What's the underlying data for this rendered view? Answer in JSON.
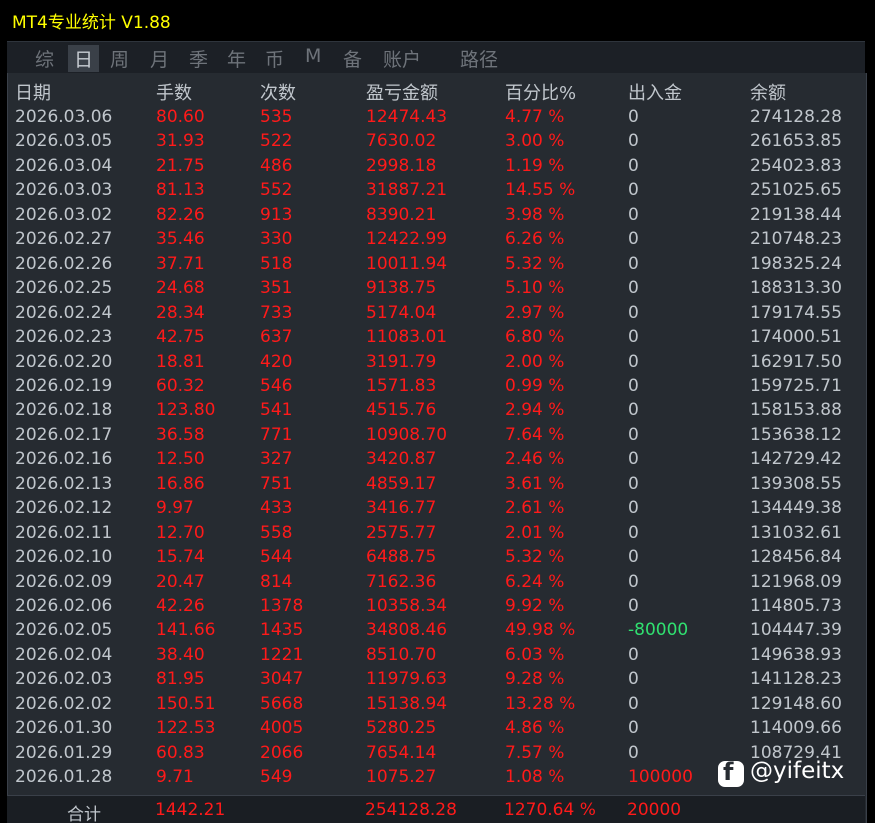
{
  "window": {
    "title": "MT4专业统计 V1.88"
  },
  "tabs": [
    {
      "label": "综",
      "active": false
    },
    {
      "label": "日",
      "active": true
    },
    {
      "label": "周",
      "active": false
    },
    {
      "label": "月",
      "active": false
    },
    {
      "label": "季",
      "active": false
    },
    {
      "label": "年",
      "active": false
    },
    {
      "label": "币",
      "active": false
    },
    {
      "label": "M",
      "active": false
    },
    {
      "label": "备",
      "active": false
    },
    {
      "label": "账户",
      "active": false
    },
    {
      "label": "路径",
      "active": false
    }
  ],
  "table": {
    "headers": {
      "date": "日期",
      "lots": "手数",
      "count": "次数",
      "pl": "盈亏金额",
      "pct": "百分比%",
      "deposit": "出入金",
      "balance": "余额"
    },
    "rows": [
      {
        "date": "2026.03.06",
        "lots": "80.60",
        "count": "535",
        "pl": "12474.43",
        "pct": "4.77 %",
        "deposit": "0",
        "balance": "274128.28"
      },
      {
        "date": "2026.03.05",
        "lots": "31.93",
        "count": "522",
        "pl": "7630.02",
        "pct": "3.00 %",
        "deposit": "0",
        "balance": "261653.85"
      },
      {
        "date": "2026.03.04",
        "lots": "21.75",
        "count": "486",
        "pl": "2998.18",
        "pct": "1.19 %",
        "deposit": "0",
        "balance": "254023.83"
      },
      {
        "date": "2026.03.03",
        "lots": "81.13",
        "count": "552",
        "pl": "31887.21",
        "pct": "14.55 %",
        "deposit": "0",
        "balance": "251025.65"
      },
      {
        "date": "2026.03.02",
        "lots": "82.26",
        "count": "913",
        "pl": "8390.21",
        "pct": "3.98 %",
        "deposit": "0",
        "balance": "219138.44"
      },
      {
        "date": "2026.02.27",
        "lots": "35.46",
        "count": "330",
        "pl": "12422.99",
        "pct": "6.26 %",
        "deposit": "0",
        "balance": "210748.23"
      },
      {
        "date": "2026.02.26",
        "lots": "37.71",
        "count": "518",
        "pl": "10011.94",
        "pct": "5.32 %",
        "deposit": "0",
        "balance": "198325.24"
      },
      {
        "date": "2026.02.25",
        "lots": "24.68",
        "count": "351",
        "pl": "9138.75",
        "pct": "5.10 %",
        "deposit": "0",
        "balance": "188313.30"
      },
      {
        "date": "2026.02.24",
        "lots": "28.34",
        "count": "733",
        "pl": "5174.04",
        "pct": "2.97 %",
        "deposit": "0",
        "balance": "179174.55"
      },
      {
        "date": "2026.02.23",
        "lots": "42.75",
        "count": "637",
        "pl": "11083.01",
        "pct": "6.80 %",
        "deposit": "0",
        "balance": "174000.51"
      },
      {
        "date": "2026.02.20",
        "lots": "18.81",
        "count": "420",
        "pl": "3191.79",
        "pct": "2.00 %",
        "deposit": "0",
        "balance": "162917.50"
      },
      {
        "date": "2026.02.19",
        "lots": "60.32",
        "count": "546",
        "pl": "1571.83",
        "pct": "0.99 %",
        "deposit": "0",
        "balance": "159725.71"
      },
      {
        "date": "2026.02.18",
        "lots": "123.80",
        "count": "541",
        "pl": "4515.76",
        "pct": "2.94 %",
        "deposit": "0",
        "balance": "158153.88"
      },
      {
        "date": "2026.02.17",
        "lots": "36.58",
        "count": "771",
        "pl": "10908.70",
        "pct": "7.64 %",
        "deposit": "0",
        "balance": "153638.12"
      },
      {
        "date": "2026.02.16",
        "lots": "12.50",
        "count": "327",
        "pl": "3420.87",
        "pct": "2.46 %",
        "deposit": "0",
        "balance": "142729.42"
      },
      {
        "date": "2026.02.13",
        "lots": "16.86",
        "count": "751",
        "pl": "4859.17",
        "pct": "3.61 %",
        "deposit": "0",
        "balance": "139308.55"
      },
      {
        "date": "2026.02.12",
        "lots": "9.97",
        "count": "433",
        "pl": "3416.77",
        "pct": "2.61 %",
        "deposit": "0",
        "balance": "134449.38"
      },
      {
        "date": "2026.02.11",
        "lots": "12.70",
        "count": "558",
        "pl": "2575.77",
        "pct": "2.01 %",
        "deposit": "0",
        "balance": "131032.61"
      },
      {
        "date": "2026.02.10",
        "lots": "15.74",
        "count": "544",
        "pl": "6488.75",
        "pct": "5.32 %",
        "deposit": "0",
        "balance": "128456.84"
      },
      {
        "date": "2026.02.09",
        "lots": "20.47",
        "count": "814",
        "pl": "7162.36",
        "pct": "6.24 %",
        "deposit": "0",
        "balance": "121968.09"
      },
      {
        "date": "2026.02.06",
        "lots": "42.26",
        "count": "1378",
        "pl": "10358.34",
        "pct": "9.92 %",
        "deposit": "0",
        "balance": "114805.73"
      },
      {
        "date": "2026.02.05",
        "lots": "141.66",
        "count": "1435",
        "pl": "34808.46",
        "pct": "49.98 %",
        "deposit": "-80000",
        "balance": "104447.39"
      },
      {
        "date": "2026.02.04",
        "lots": "38.40",
        "count": "1221",
        "pl": "8510.70",
        "pct": "6.03 %",
        "deposit": "0",
        "balance": "149638.93"
      },
      {
        "date": "2026.02.03",
        "lots": "81.95",
        "count": "3047",
        "pl": "11979.63",
        "pct": "9.28 %",
        "deposit": "0",
        "balance": "141128.23"
      },
      {
        "date": "2026.02.02",
        "lots": "150.51",
        "count": "5668",
        "pl": "15138.94",
        "pct": "13.28 %",
        "deposit": "0",
        "balance": "129148.60"
      },
      {
        "date": "2026.01.30",
        "lots": "122.53",
        "count": "4005",
        "pl": "5280.25",
        "pct": "4.86 %",
        "deposit": "0",
        "balance": "114009.66"
      },
      {
        "date": "2026.01.29",
        "lots": "60.83",
        "count": "2066",
        "pl": "7654.14",
        "pct": "7.57 %",
        "deposit": "0",
        "balance": "108729.41"
      },
      {
        "date": "2026.01.28",
        "lots": "9.71",
        "count": "549",
        "pl": "1075.27",
        "pct": "1.08 %",
        "deposit": "100000",
        "balance": ""
      }
    ],
    "total": {
      "label": "合计",
      "lots": "1442.21",
      "pl": "254128.28",
      "pct": "1270.64 %",
      "deposit": "20000"
    }
  },
  "watermark": {
    "icon": "facebook-icon",
    "text": "@yifeitx"
  },
  "colors": {
    "title": "#ffff00",
    "profit": "#ff1a1a",
    "withdrawal": "#30e070",
    "text": "#c0c6cc",
    "panel": "#262b31"
  }
}
